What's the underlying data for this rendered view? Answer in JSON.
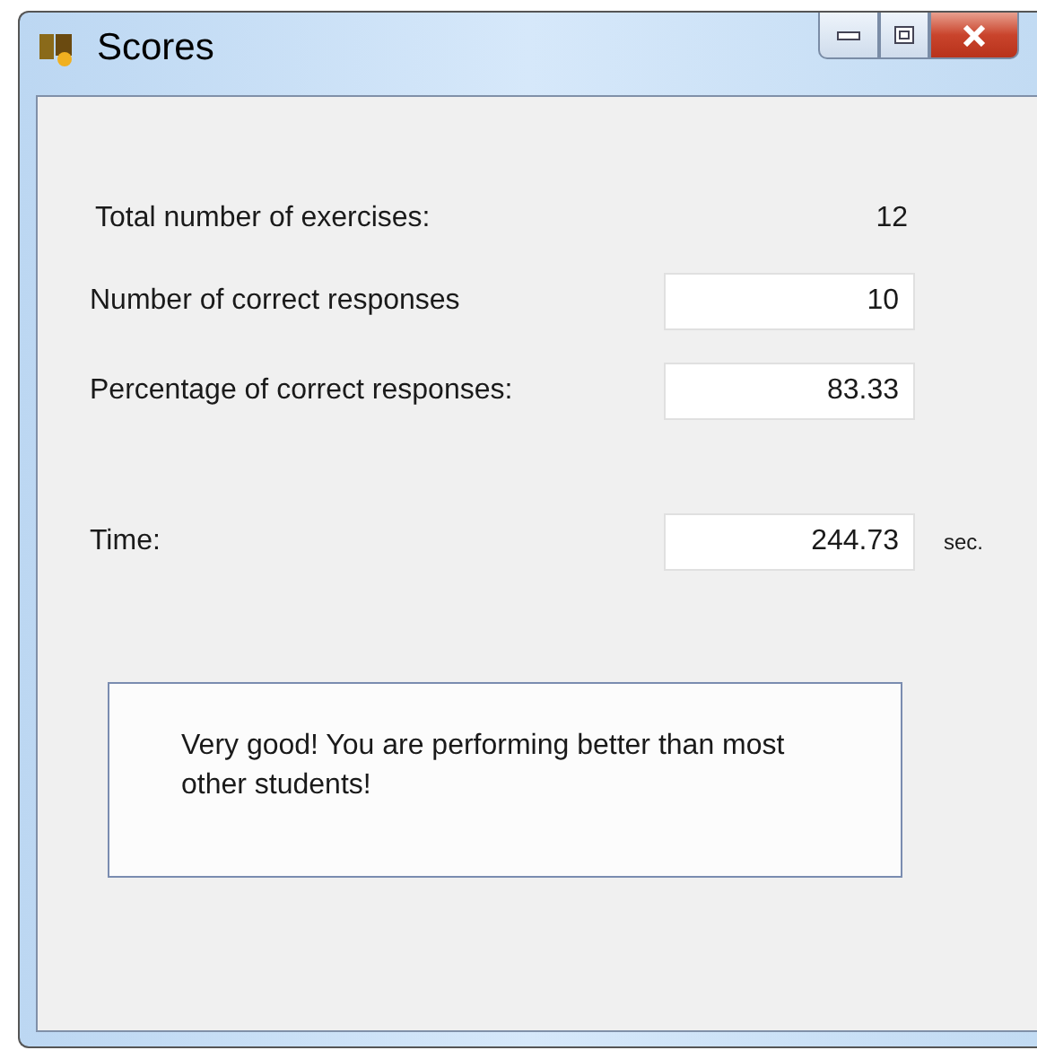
{
  "window": {
    "title": "Scores"
  },
  "rows": [
    {
      "kind": "text",
      "label": "Total number of exercises:",
      "value": "12"
    },
    {
      "kind": "field",
      "label": "Number of correct responses",
      "value": "10"
    },
    {
      "kind": "field",
      "label": "Percentage of correct responses:",
      "value": "83.33"
    },
    {
      "kind": "field",
      "label": "Time:",
      "value": "244.73",
      "unit": "sec."
    }
  ],
  "message": "Very good! You are performing better than most other students!"
}
